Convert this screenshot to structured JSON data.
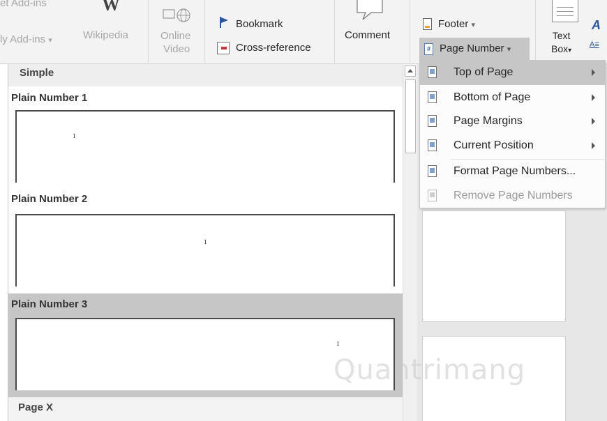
{
  "ribbon": {
    "add_ins": {
      "get_label": "et Add-ins",
      "my_label": "ly Add-ins",
      "my_caret": "▾"
    },
    "wikipedia_label": "Wikipedia",
    "online_video": {
      "line1": "Online",
      "line2": "Video"
    },
    "bookmark_label": "Bookmark",
    "cross_reference_label": "Cross-reference",
    "comment_label": "Comment",
    "footer_label": "Footer",
    "footer_caret": "▾",
    "page_number_label": "Page Number",
    "page_number_caret": "▾",
    "text_box": {
      "line1": "Text",
      "line2": "Box",
      "caret": "▾"
    }
  },
  "gallery": {
    "category": "Simple",
    "items": [
      {
        "title": "Plain Number 1",
        "num": "1"
      },
      {
        "title": "Plain Number 2",
        "num": "1"
      },
      {
        "title": "Plain Number 3",
        "num": "1"
      },
      {
        "title": "Page X"
      }
    ]
  },
  "menu": {
    "items": [
      {
        "label": "Top of Page",
        "submenu": true,
        "highlighted": true,
        "enabled": true
      },
      {
        "label": "Bottom of Page",
        "submenu": true,
        "highlighted": false,
        "enabled": true
      },
      {
        "label": "Page Margins",
        "submenu": true,
        "highlighted": false,
        "enabled": true
      },
      {
        "label": "Current Position",
        "submenu": true,
        "highlighted": false,
        "enabled": true
      },
      {
        "label": "Format Page Numbers...",
        "submenu": false,
        "highlighted": false,
        "enabled": true
      },
      {
        "label": "Remove Page Numbers",
        "submenu": false,
        "highlighted": false,
        "enabled": false
      }
    ]
  },
  "watermark": "Quantrimang",
  "colors": {
    "accent": "#2b579a",
    "highlight": "#c6c6c6",
    "ribbon_bg": "#f3f3f3"
  }
}
